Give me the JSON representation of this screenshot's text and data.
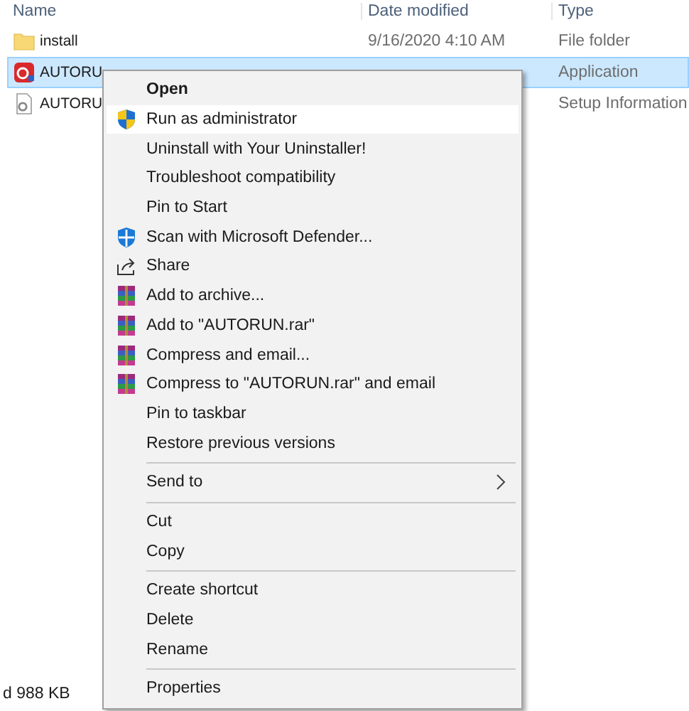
{
  "columns": [
    "Name",
    "Date modified",
    "Type"
  ],
  "files": [
    {
      "name": "install",
      "date": "9/16/2020 4:10 AM",
      "type": "File folder",
      "kind": "folder",
      "selected": false
    },
    {
      "name": "AUTORU",
      "type": "Application",
      "kind": "app",
      "selected": true
    },
    {
      "name": "AUTORU",
      "type": "Setup Information",
      "kind": "setup",
      "selected": false
    }
  ],
  "status_bar": "d 988 KB",
  "menu": [
    {
      "label": "Open",
      "kind": "plain",
      "bold": true,
      "selected": false
    },
    {
      "label": "Run as administrator",
      "kind": "shield",
      "selected": true
    },
    {
      "label": "Uninstall with Your Uninstaller!",
      "kind": "plain",
      "selected": false
    },
    {
      "label": "Troubleshoot compatibility",
      "kind": "plain",
      "selected": false
    },
    {
      "label": "Pin to Start",
      "kind": "plain",
      "selected": false
    },
    {
      "label": "Scan with Microsoft Defender...",
      "kind": "defender",
      "selected": false
    },
    {
      "label": "Share",
      "kind": "share",
      "selected": false
    },
    {
      "label": "Add to archive...",
      "kind": "archive",
      "selected": false
    },
    {
      "label": "Add to \"AUTORUN.rar\"",
      "kind": "archive",
      "selected": false
    },
    {
      "label": "Compress and email...",
      "kind": "archive",
      "selected": false
    },
    {
      "label": "Compress to \"AUTORUN.rar\" and email",
      "kind": "archive",
      "selected": false
    },
    {
      "label": "Pin to taskbar",
      "kind": "plain",
      "selected": false
    },
    {
      "label": "Restore previous versions",
      "kind": "plain",
      "selected": false,
      "separator_after": true
    },
    {
      "label": "Send to",
      "kind": "plain",
      "submenu": true,
      "selected": false,
      "separator_after": true
    },
    {
      "label": "Cut",
      "kind": "plain",
      "selected": false
    },
    {
      "label": "Copy",
      "kind": "plain",
      "selected": false,
      "separator_after": true
    },
    {
      "label": "Create shortcut",
      "kind": "plain",
      "selected": false
    },
    {
      "label": "Delete",
      "kind": "plain",
      "selected": false
    },
    {
      "label": "Rename",
      "kind": "plain",
      "selected": false,
      "separator_after": true
    },
    {
      "label": "Properties",
      "kind": "plain",
      "selected": false
    }
  ]
}
